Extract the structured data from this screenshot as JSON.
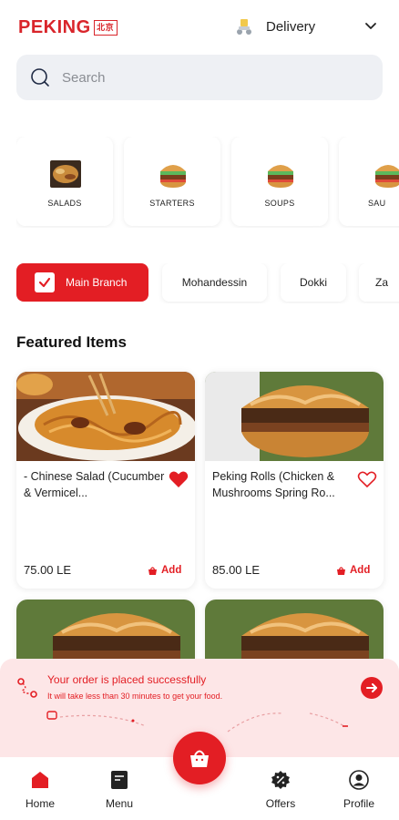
{
  "header": {
    "logo_text": "PEKING",
    "logo_mark": "北京",
    "delivery_label": "Delivery"
  },
  "search": {
    "placeholder": "Search"
  },
  "categories": [
    {
      "label": "SALADS"
    },
    {
      "label": "STARTERS"
    },
    {
      "label": "SOUPS"
    },
    {
      "label": "SAU"
    }
  ],
  "branches": [
    {
      "label": "Main Branch",
      "selected": true
    },
    {
      "label": "Mohandessin",
      "selected": false
    },
    {
      "label": "Dokki",
      "selected": false
    },
    {
      "label": "Za",
      "selected": false
    }
  ],
  "featured": {
    "title": "Featured Items",
    "items": [
      {
        "name": "- Chinese Salad (Cucumber & Vermicel...",
        "price": "75.00 LE",
        "add_label": "Add",
        "favorite": true
      },
      {
        "name": "Peking Rolls (Chicken & Mushrooms Spring Ro...",
        "price": "85.00 LE",
        "add_label": "Add",
        "favorite": false
      }
    ]
  },
  "toast": {
    "title": "Your order is placed successfully",
    "subtitle": "It will take less than  30  minutes to get your food."
  },
  "nav": {
    "home": "Home",
    "menu": "Menu",
    "offers": "Offers",
    "profile": "Profile"
  },
  "colors": {
    "brand_red": "#e31e24",
    "toast_bg": "#fde6e7",
    "search_bg": "#eef0f4"
  }
}
